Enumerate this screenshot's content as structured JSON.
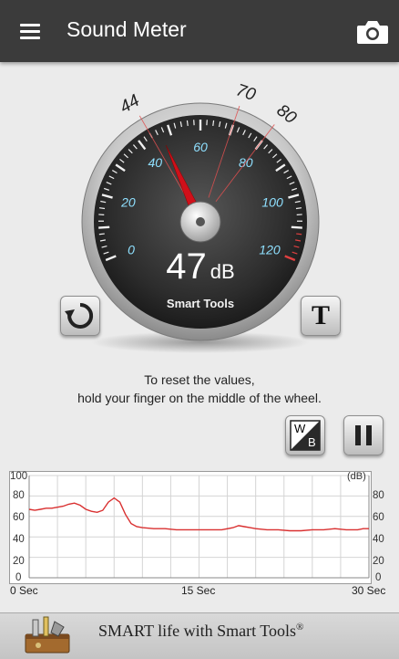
{
  "appbar": {
    "title": "Sound Meter",
    "menu_icon": "hamburger-menu-icon",
    "camera_icon": "camera-icon"
  },
  "gauge": {
    "reading": "47",
    "unit": "dB",
    "brand": "Smart Tools",
    "needle_value_db": 47,
    "min_marker": "44",
    "avg_marker": "70",
    "max_marker": "80",
    "scale_labels": [
      "0",
      "20",
      "40",
      "60",
      "80",
      "100",
      "120"
    ],
    "dial_range_db": [
      0,
      120
    ]
  },
  "buttons": {
    "reset_icon": "refresh-icon",
    "theme_label": "T",
    "white_balance_label_w": "W",
    "white_balance_label_b": "B",
    "pause_icon": "pause-icon"
  },
  "hint": {
    "line1": "To reset the values,",
    "line2": "hold your finger on the middle of the wheel."
  },
  "graph": {
    "unit_label": "(dB)",
    "y_ticks": [
      "100",
      "80",
      "60",
      "40",
      "20",
      "0"
    ],
    "x_labels": [
      "0 Sec",
      "15 Sec",
      "30 Sec"
    ],
    "line_color": "#d93030"
  },
  "chart_data": {
    "type": "line",
    "xlabel": "",
    "ylabel": "(dB)",
    "xlim": [
      0,
      30
    ],
    "ylim": [
      0,
      100
    ],
    "x_ticks": [
      "0 Sec",
      "15 Sec",
      "30 Sec"
    ],
    "grid": true,
    "series": [
      {
        "x": [
          0,
          0.5,
          1,
          1.5,
          2,
          2.5,
          3,
          3.5,
          4,
          4.5,
          5,
          5.5,
          6,
          6.5,
          7,
          7.5,
          8,
          8.5,
          9,
          9.5,
          10,
          11,
          12,
          13,
          14,
          15,
          16,
          17,
          18,
          18.5,
          19,
          19.5,
          20,
          21,
          22,
          23,
          24,
          25,
          26,
          27,
          28,
          29,
          29.5,
          30
        ],
        "y": [
          67,
          66,
          67,
          68,
          68,
          69,
          70,
          72,
          73,
          71,
          67,
          65,
          64,
          66,
          74,
          78,
          74,
          62,
          53,
          50,
          49,
          48,
          48,
          47,
          47,
          47,
          47,
          47,
          49,
          51,
          50,
          49,
          48,
          47,
          47,
          46,
          46,
          47,
          47,
          48,
          47,
          47,
          48,
          48
        ]
      }
    ]
  },
  "footer": {
    "logo_icon": "toolbox-logo-icon",
    "tagline": "SMART life with Smart Tools",
    "registered": "®"
  }
}
